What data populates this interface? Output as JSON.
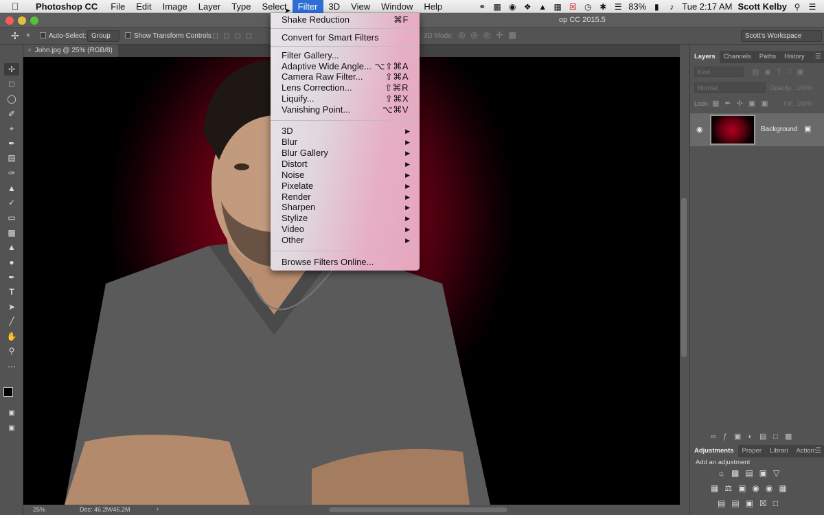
{
  "menubar": {
    "app_name": "Photoshop CC",
    "items": [
      "File",
      "Edit",
      "Image",
      "Layer",
      "Type",
      "Select",
      "Filter",
      "3D",
      "View",
      "Window",
      "Help"
    ],
    "active": "Filter",
    "battery": "83%",
    "clock": "Tue 2:17 AM",
    "user": "Scott Kelby"
  },
  "window": {
    "title": "op CC 2015.5"
  },
  "optionsbar": {
    "auto_select_label": "Auto-Select:",
    "auto_select_value": "Group",
    "show_transform_label": "Show Transform Controls",
    "mode_3d_label": "3D Mode:",
    "workspace": "Scott's Workspace"
  },
  "document": {
    "tab_title": "John.jpg @ 25% (RGB/8)",
    "zoom": "25%",
    "doc_size": "Doc: 46.2M/46.2M"
  },
  "filter_menu": {
    "group1": [
      {
        "label": "Shake Reduction",
        "shortcut": "⌘F"
      }
    ],
    "group2": [
      {
        "label": "Convert for Smart Filters",
        "shortcut": ""
      }
    ],
    "group3": [
      {
        "label": "Filter Gallery...",
        "shortcut": ""
      },
      {
        "label": "Adaptive Wide Angle...",
        "shortcut": "⌥⇧⌘A"
      },
      {
        "label": "Camera Raw Filter...",
        "shortcut": "⇧⌘A"
      },
      {
        "label": "Lens Correction...",
        "shortcut": "⇧⌘R"
      },
      {
        "label": "Liquify...",
        "shortcut": "⇧⌘X"
      },
      {
        "label": "Vanishing Point...",
        "shortcut": "⌥⌘V"
      }
    ],
    "group4": [
      "3D",
      "Blur",
      "Blur Gallery",
      "Distort",
      "Noise",
      "Pixelate",
      "Render",
      "Sharpen",
      "Stylize",
      "Video",
      "Other"
    ],
    "group5": [
      {
        "label": "Browse Filters Online...",
        "shortcut": ""
      }
    ]
  },
  "layers_panel": {
    "tabs": [
      "Layers",
      "Channels",
      "Paths",
      "History"
    ],
    "kind_placeholder": "Kind",
    "blend_mode": "Normal",
    "opacity_label": "Opacity:",
    "opacity_value": "100%",
    "lock_label": "Lock:",
    "fill_label": "Fill:",
    "fill_value": "100%",
    "layer_name": "Background"
  },
  "adjustments_panel": {
    "tabs": [
      "Adjustments",
      "Proper",
      "Librari",
      "Action:"
    ],
    "subtitle": "Add an adjustment"
  }
}
